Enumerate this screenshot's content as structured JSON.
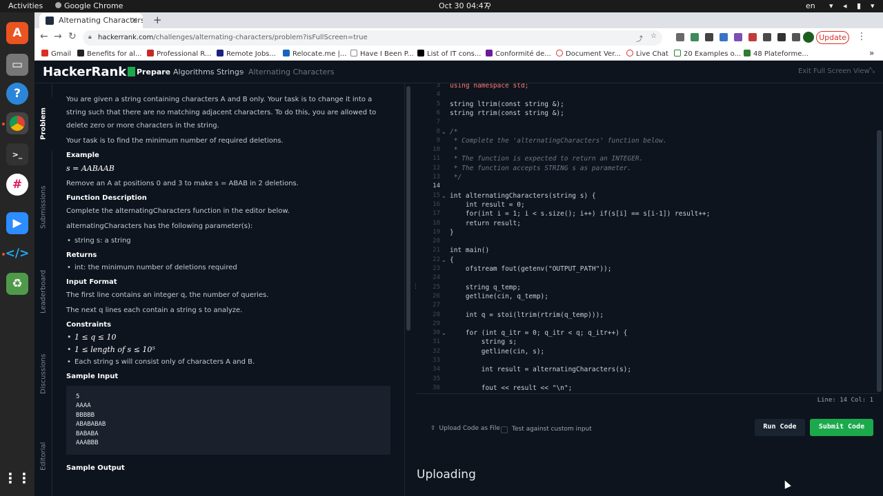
{
  "system": {
    "activities": "Activities",
    "app": "Google Chrome",
    "datetime": "Oct 30  04:47",
    "lang": "en"
  },
  "browser": {
    "tab_title": "Alternating Characters | I",
    "url_domain": "hackerrank.com",
    "url_path": "/challenges/alternating-characters/problem?isFullScreen=true",
    "update_label": "Update",
    "bookmarks": [
      "Gmail",
      "Benefits for al...",
      "Professional R...",
      "Remote Jobs...",
      "Relocate.me |...",
      "Have I Been P...",
      "List of IT cons...",
      "Conformité de...",
      "Document Ver...",
      "Live Chat",
      "20 Examples o...",
      "48 Plateforme..."
    ]
  },
  "header": {
    "logo": "HackerRank",
    "crumbs": [
      "Prepare",
      "Algorithms",
      "Strings",
      "Alternating Characters"
    ],
    "exit_fullscreen": "Exit Full Screen View"
  },
  "vtabs": [
    "Problem",
    "Submissions",
    "Leaderboard",
    "Discussions",
    "Editorial"
  ],
  "problem": {
    "intro1": "You are given a string containing characters A and B only. Your task is to change it into a string such that there are no matching adjacent characters. To do this, you are allowed to delete zero or more characters in the string.",
    "intro2": "Your task is to find the minimum number of required deletions.",
    "example_h": "Example",
    "example_s": "s = AABAAB",
    "example_text": "Remove an A at positions 0 and 3 to make s = ABAB in 2 deletions.",
    "func_h": "Function Description",
    "func_text": "Complete the alternatingCharacters function in the editor below.",
    "params_text": "alternatingCharacters has the following parameter(s):",
    "param1": "string s: a string",
    "returns_h": "Returns",
    "return1": "int: the minimum number of deletions required",
    "input_h": "Input Format",
    "input1": "The first line contains an integer q, the number of queries.",
    "input2": "The next q lines each contain a string s to analyze.",
    "constraints_h": "Constraints",
    "c1": "1 ≤ q ≤ 10",
    "c2": "1 ≤  length of s  ≤ 10⁵",
    "c3": "Each string s will consist only of characters A and B.",
    "sample_in_h": "Sample Input",
    "sample_in": [
      "5",
      "AAAA",
      "BBBBB",
      "ABABABAB",
      "BABABA",
      "AAABBB"
    ],
    "sample_out_h": "Sample Output"
  },
  "editor": {
    "lines": [
      {
        "n": "3",
        "t": "using namespace std;",
        "c": "kw"
      },
      {
        "n": "4",
        "t": "",
        "c": "pl"
      },
      {
        "n": "5",
        "t": "string ltrim(const string &);",
        "c": "pl"
      },
      {
        "n": "6",
        "t": "string rtrim(const string &);",
        "c": "pl"
      },
      {
        "n": "7",
        "t": "",
        "c": "pl"
      },
      {
        "n": "8",
        "t": "/*",
        "c": "com"
      },
      {
        "n": "9",
        "t": " * Complete the 'alternatingCharacters' function below.",
        "c": "com"
      },
      {
        "n": "10",
        "t": " *",
        "c": "com"
      },
      {
        "n": "11",
        "t": " * The function is expected to return an INTEGER.",
        "c": "com"
      },
      {
        "n": "12",
        "t": " * The function accepts STRING s as parameter.",
        "c": "com"
      },
      {
        "n": "13",
        "t": " */",
        "c": "com"
      },
      {
        "n": "14",
        "t": "",
        "c": "pl"
      },
      {
        "n": "15",
        "t": "int alternatingCharacters(string s) {",
        "c": "pl"
      },
      {
        "n": "16",
        "t": "    int result = 0;",
        "c": "pl"
      },
      {
        "n": "17",
        "t": "    for(int i = 1; i < s.size(); i++) if(s[i] == s[i-1]) result++;",
        "c": "pl"
      },
      {
        "n": "18",
        "t": "    return result;",
        "c": "pl"
      },
      {
        "n": "19",
        "t": "}",
        "c": "pl"
      },
      {
        "n": "20",
        "t": "",
        "c": "pl"
      },
      {
        "n": "21",
        "t": "int main()",
        "c": "pl"
      },
      {
        "n": "22",
        "t": "{",
        "c": "pl"
      },
      {
        "n": "23",
        "t": "    ofstream fout(getenv(\"OUTPUT_PATH\"));",
        "c": "pl"
      },
      {
        "n": "24",
        "t": "",
        "c": "pl"
      },
      {
        "n": "25",
        "t": "    string q_temp;",
        "c": "pl"
      },
      {
        "n": "26",
        "t": "    getline(cin, q_temp);",
        "c": "pl"
      },
      {
        "n": "27",
        "t": "",
        "c": "pl"
      },
      {
        "n": "28",
        "t": "    int q = stoi(ltrim(rtrim(q_temp)));",
        "c": "pl"
      },
      {
        "n": "29",
        "t": "",
        "c": "pl"
      },
      {
        "n": "30",
        "t": "    for (int q_itr = 0; q_itr < q; q_itr++) {",
        "c": "pl"
      },
      {
        "n": "31",
        "t": "        string s;",
        "c": "pl"
      },
      {
        "n": "32",
        "t": "        getline(cin, s);",
        "c": "pl"
      },
      {
        "n": "33",
        "t": "",
        "c": "pl"
      },
      {
        "n": "34",
        "t": "        int result = alternatingCharacters(s);",
        "c": "pl"
      },
      {
        "n": "35",
        "t": "",
        "c": "pl"
      },
      {
        "n": "36",
        "t": "        fout << result << \"\\n\";",
        "c": "pl"
      }
    ],
    "current_line": "14",
    "status": "Line: 14 Col: 1"
  },
  "controls": {
    "upload": "Upload Code as File",
    "test": "Test against custom input",
    "run": "Run Code",
    "submit": "Submit Code",
    "uploading": "Uploading"
  },
  "colors": {
    "green": "#1ba94c",
    "bg": "#0e141e"
  }
}
